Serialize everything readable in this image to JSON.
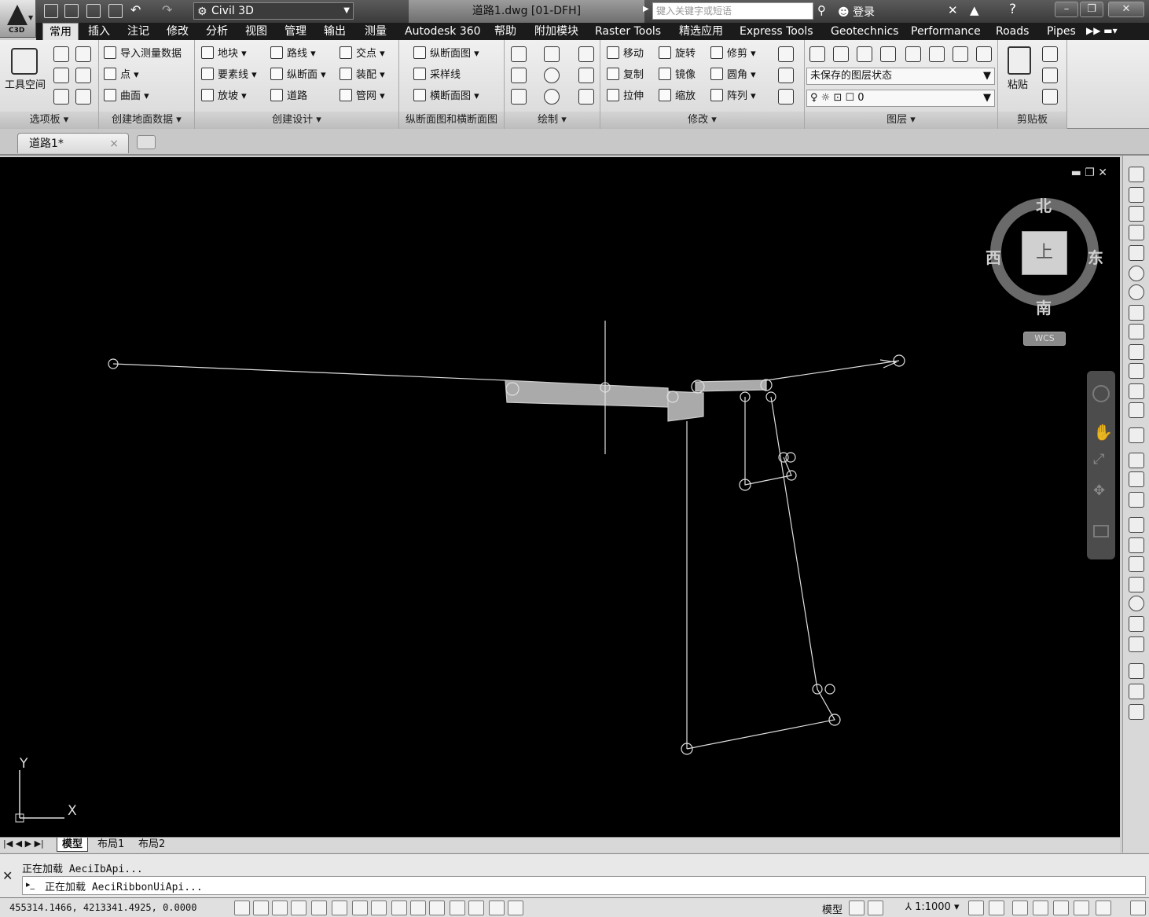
{
  "window": {
    "workspace": "Civil 3D",
    "doc_title": "道路1.dwg [01-DFH]",
    "search_placeholder": "键入关键字或短语",
    "login_label": "登录",
    "app_badge": "C3D"
  },
  "tabs": [
    "常用",
    "插入",
    "注记",
    "修改",
    "分析",
    "视图",
    "管理",
    "输出",
    "测量",
    "Autodesk 360",
    "帮助",
    "附加模块",
    "Raster Tools",
    "精选应用",
    "Express Tools",
    "Geotechnics",
    "Performance",
    "Roads",
    "Pipes"
  ],
  "active_tab": "常用",
  "ribbon": {
    "panel_titles": {
      "palettes": "选项板",
      "ground": "创建地面数据",
      "design": "创建设计",
      "profile_section": "纵断面图和横断面图",
      "draw": "绘制",
      "modify": "修改",
      "layers": "图层",
      "clipboard": "剪贴板"
    },
    "toolspace_label": "工具空间",
    "ground_items": [
      "导入测量数据",
      "点",
      "曲面"
    ],
    "design_col1": [
      "地块",
      "要素线",
      "放坡"
    ],
    "design_col2": [
      "路线",
      "纵断面",
      "道路"
    ],
    "design_col3": [
      "交点",
      "装配",
      "管网"
    ],
    "profile_items": [
      "纵断面图",
      "采样线",
      "横断面图"
    ],
    "modify_col1": [
      "移动",
      "复制",
      "拉伸"
    ],
    "modify_col2": [
      "旋转",
      "镜像",
      "缩放"
    ],
    "modify_col3": [
      "修剪",
      "圆角",
      "阵列"
    ],
    "layer_state": "未保存的图层状态",
    "layer_current": "0",
    "paste_label": "粘贴"
  },
  "file_tab": {
    "label": "道路1*",
    "close": "×"
  },
  "viewcube": {
    "north": "北",
    "south": "南",
    "east": "东",
    "west": "西",
    "top": "上",
    "wcs": "WCS"
  },
  "ucs": {
    "x": "X",
    "y": "Y"
  },
  "layout_tabs": [
    "模型",
    "布局1",
    "布局2"
  ],
  "active_layout": "模型",
  "command": {
    "line1": "正在加载 AeciIbApi...",
    "line2": "正在加载 AeciRibbonUiApi..."
  },
  "status": {
    "coordinates": "455314.1466, 4213341.4925, 0.0000",
    "model_label": "模型",
    "scale": "1:1000"
  },
  "colors": {
    "canvas": "#000000",
    "drawing_line": "#e0e0e0",
    "ribbon_bg": "#e6e6e6",
    "tabbar": "#1b1b1b"
  }
}
